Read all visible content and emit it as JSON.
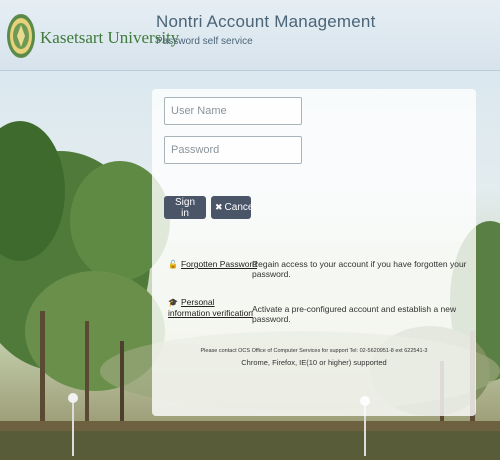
{
  "header": {
    "university": "Kasetsart University",
    "app_title": "Nontri Account Management",
    "app_subtitle": "Password self service",
    "logo_icon": "kasetsart-seal-icon"
  },
  "login": {
    "username_placeholder": "User Name",
    "password_placeholder": "Password",
    "signin_label": "Sign in",
    "cancel_label": "Cancel",
    "cancel_icon": "close-icon"
  },
  "options": [
    {
      "icon": "unlock-icon",
      "link_line1": "Forgotten Password",
      "link_line2": "",
      "description": "Regain access to your account if you have forgotten your password."
    },
    {
      "icon": "graduation-cap-icon",
      "link_line1": "Personal",
      "link_line2": "information verification",
      "description": "Activate a pre-configured account and establish a new password."
    }
  ],
  "footer": {
    "contact": "Please contact OCS Office of Computer Services for support Tel: 02-5620951-8 ext 622541-3",
    "browsers": "Chrome, Firefox, IE(10 or higher) supported"
  },
  "colors": {
    "header_bg": "#dfe9f0",
    "title_text": "#4a6478",
    "university_green": "#3f7a3a",
    "button_bg": "#4b5568"
  }
}
